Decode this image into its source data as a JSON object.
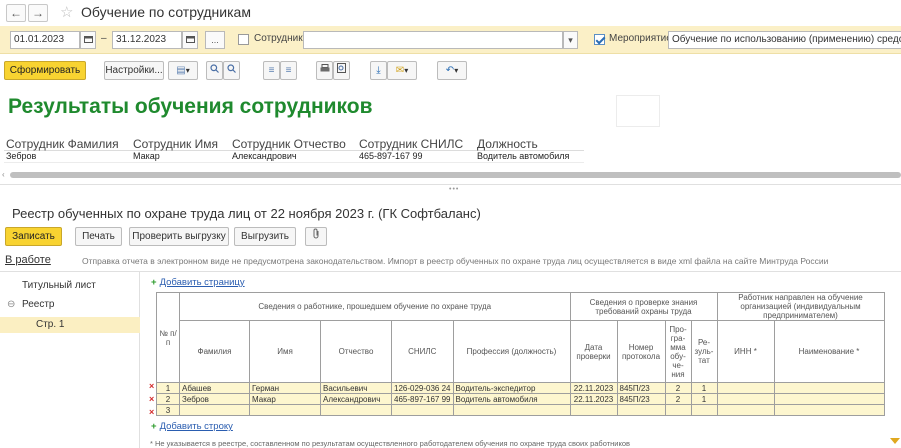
{
  "window": {
    "title": "Обучение по сотрудникам",
    "back_glyph": "←",
    "forward_glyph": "→",
    "star_glyph": "☆"
  },
  "filters": {
    "date_from": "01.01.2023",
    "date_sep": "–",
    "date_to": "31.12.2023",
    "period_btn": "...",
    "employee_checked": false,
    "employee_label": "Сотрудник:",
    "employee_value": "",
    "event_checked": true,
    "event_label": "Мероприятие:",
    "event_value": "Обучение по использованию (применению) средств индивидуальной защиты"
  },
  "toolbar": {
    "generate": "Сформировать",
    "settings": "Настройки..."
  },
  "report": {
    "title": "Результаты обучения сотрудников",
    "columns": [
      "Сотрудник Фамилия",
      "Сотрудник Имя",
      "Сотрудник Отчество",
      "Сотрудник СНИЛС",
      "Должность"
    ],
    "rows": [
      [
        "Зебров",
        "Макар",
        "Александрович",
        "465-897-167 99",
        "Водитель автомобиля"
      ]
    ]
  },
  "form2": {
    "title": "Реестр обученных по охране труда лиц от 22 ноября 2023 г. (ГК Софтбаланс)",
    "buttons": {
      "save": "Записать",
      "print": "Печать",
      "check": "Проверить выгрузку",
      "export": "Выгрузить"
    },
    "status": "В работе",
    "info": "Отправка отчета в электронном виде не предусмотрена законодательством. Импорт в реестр обученных по охране труда лиц осуществляется в виде xml файла на сайте Минтруда России",
    "sheets": {
      "title_sheet": "Титульный лист",
      "registry": "Реестр",
      "page1": "Стр. 1"
    },
    "add_page": "Добавить страницу",
    "add_row": "Добавить строку",
    "grid": {
      "h_num": "№ п/п",
      "h_group_worker": "Сведения о работнике, прошедшем обучение по охране труда",
      "h_group_check": "Сведения о проверке знания требований охраны труда",
      "h_group_employer": "Работник направлен на обучение организацией (индивидуальным предпринимателем)",
      "h_last": "Фамилия",
      "h_first": "Имя",
      "h_middle": "Отчество",
      "h_snils": "СНИЛС",
      "h_prof": "Профессия (должность)",
      "h_date": "Дата проверки",
      "h_protocol": "Номер протокола",
      "h_program": "Про-гра-мма обу-че-ния",
      "h_result": "Ре-зуль-тат",
      "h_inn": "ИНН *",
      "h_name": "Наименование *",
      "rows": [
        {
          "n": "1",
          "last": "Абашев",
          "first": "Герман",
          "middle": "Васильевич",
          "snils": "126-029-036 24",
          "prof": "Водитель-экспедитор",
          "date": "22.11.2023",
          "protocol": "845П/23",
          "program": "2",
          "result": "1",
          "inn": "",
          "name": ""
        },
        {
          "n": "2",
          "last": "Зебров",
          "first": "Макар",
          "middle": "Александрович",
          "snils": "465-897-167 99",
          "prof": "Водитель автомобиля",
          "date": "22.11.2023",
          "protocol": "845П/23",
          "program": "2",
          "result": "1",
          "inn": "",
          "name": ""
        },
        {
          "n": "3",
          "last": "",
          "first": "",
          "middle": "",
          "snils": "",
          "prof": "",
          "date": "",
          "protocol": "",
          "program": "",
          "result": "",
          "inn": "",
          "name": ""
        }
      ]
    },
    "footnote": "* Не указывается в реестре, составленном по результатам осуществленного работодателем обучения по охране труда своих работников"
  },
  "colors": {
    "accent_yellow": "#f8d331",
    "filter_bg": "#fbf0c7",
    "title_green": "#1f8a2e",
    "link_blue": "#2a5db0",
    "delete_red": "#d32b2b"
  },
  "icons": [
    "back-arrow-icon",
    "forward-arrow-icon",
    "star-icon",
    "calendar-icon",
    "dropdown-icon",
    "checkbox-icon",
    "search-icon",
    "expand-icon",
    "collapse-icon",
    "print-icon",
    "preview-icon",
    "export-icon",
    "mail-icon",
    "undo-icon",
    "attach-icon",
    "delete-row-icon",
    "plus-icon"
  ]
}
